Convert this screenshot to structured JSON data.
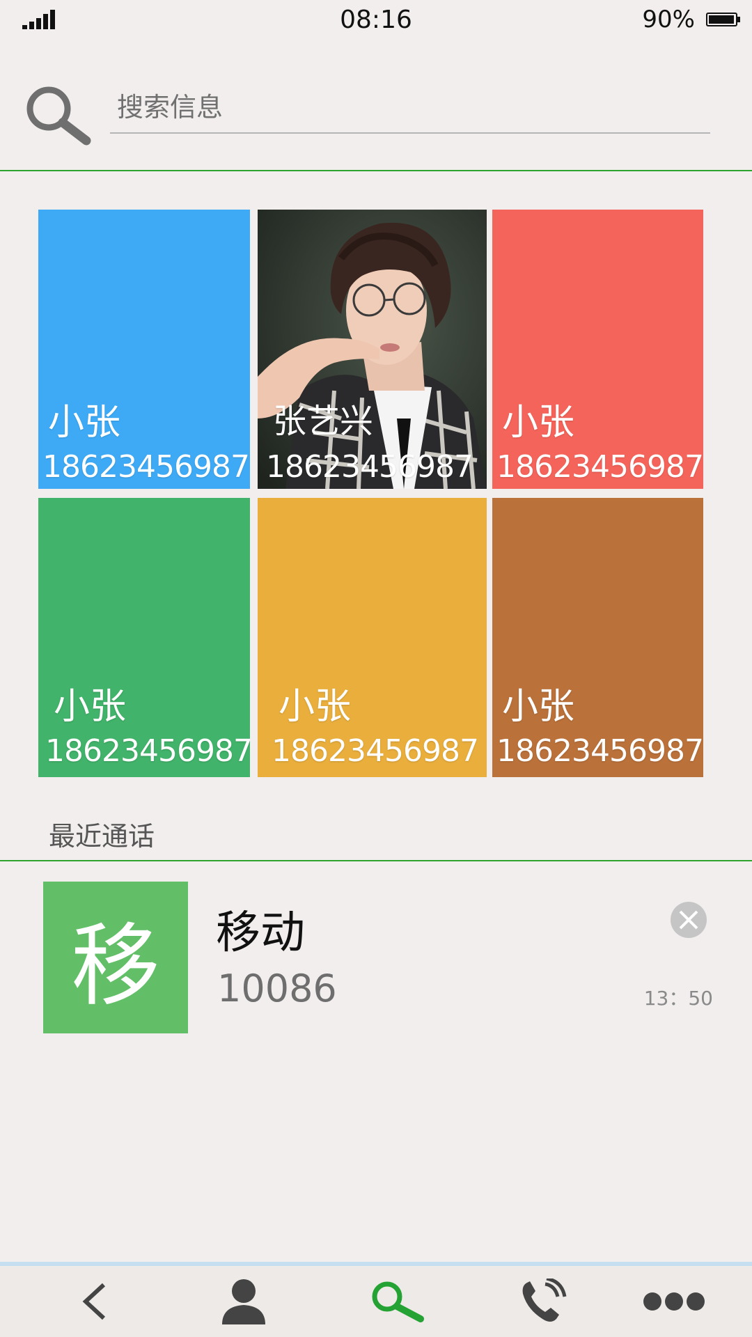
{
  "status_bar": {
    "time": "08:16",
    "battery": "90%"
  },
  "search": {
    "placeholder": "搜索信息"
  },
  "favorites": [
    {
      "name": "小张",
      "phone": "18623456987",
      "color": "#3eaaf6"
    },
    {
      "name": "张艺兴",
      "phone": "18623456987",
      "color": "photo"
    },
    {
      "name": "小张",
      "phone": "18623456987",
      "color": "#f5645a"
    },
    {
      "name": "小张",
      "phone": "18623456987",
      "color": "#41b36a"
    },
    {
      "name": "小张",
      "phone": "18623456987",
      "color": "#e9ae3c"
    },
    {
      "name": "小张",
      "phone": "18623456987",
      "color": "#ba713a"
    }
  ],
  "recent": {
    "label": "最近通话",
    "calls": [
      {
        "avatar_char": "移",
        "name": "移动",
        "number": "10086",
        "time": "13：50",
        "avatar_color": "#62bf67"
      }
    ]
  },
  "bottom_nav": {
    "items": [
      "back-icon",
      "contacts-icon",
      "search-icon",
      "phone-call-icon",
      "more-icon"
    ],
    "active": "search-icon",
    "active_color": "#25a234"
  }
}
